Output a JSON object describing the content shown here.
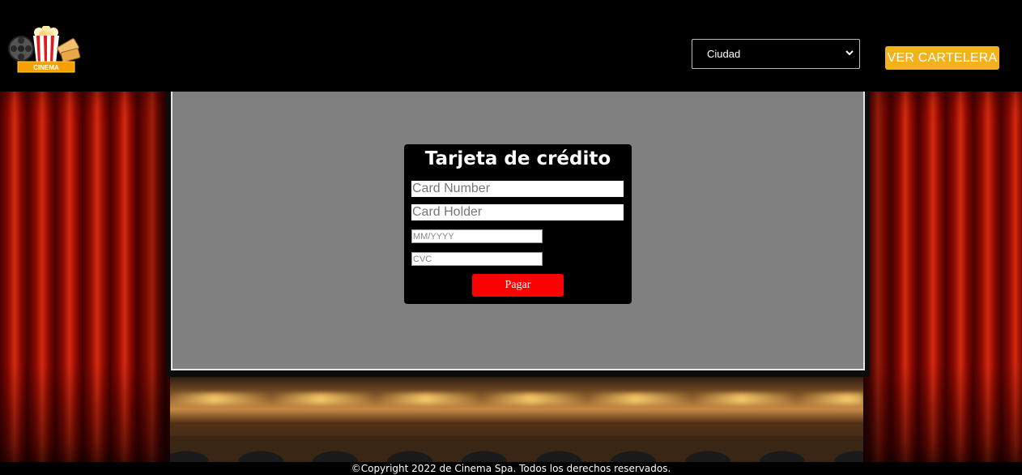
{
  "header": {
    "logo_label": "CINEMA",
    "city_select": {
      "selected": "Ciudad",
      "options": [
        "Ciudad"
      ]
    },
    "cartelera_button": "VER CARTELERA"
  },
  "payment_form": {
    "title": "Tarjeta de crédito",
    "card_number_placeholder": "Card Number",
    "card_holder_placeholder": "Card Holder",
    "expiry_placeholder": "MM/YYYY",
    "cvc_placeholder": "CVC",
    "submit_label": "Pagar"
  },
  "footer": {
    "copyright": "©Copyright 2022 de Cinema Spa. Todos los derechos reservados."
  },
  "colors": {
    "header_bg": "#000000",
    "accent_button": "#f2b21c",
    "pay_button": "#ff0000",
    "screen": "#808080",
    "curtain": "#b3190b"
  },
  "icons": [
    "cinema-logo-icon",
    "film-reel-icon",
    "popcorn-icon",
    "ticket-icon",
    "chevron-down-icon"
  ]
}
